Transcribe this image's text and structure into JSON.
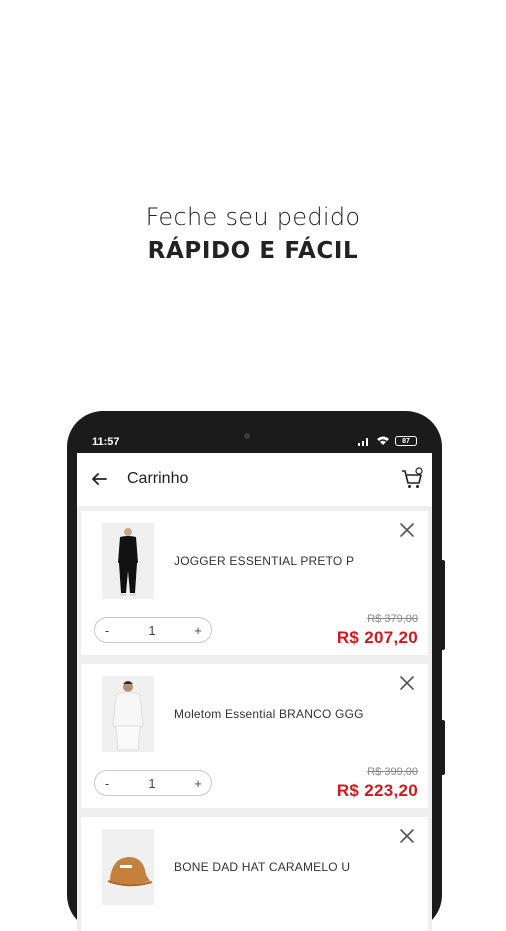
{
  "headline": {
    "line1": "Feche seu pedido",
    "line2": "RÁPIDO E FÁCIL"
  },
  "status_bar": {
    "time": "11:57",
    "battery": "87"
  },
  "appbar": {
    "title": "Carrinho"
  },
  "cart_items": [
    {
      "name": "JOGGER ESSENTIAL PRETO P",
      "quantity": "1",
      "old_price": "R$ 379,00",
      "price": "R$  207,20",
      "minus": "-",
      "plus": "+"
    },
    {
      "name": "Moletom Essential BRANCO GGG",
      "quantity": "1",
      "old_price": "R$ 399,00",
      "price": "R$  223,20",
      "minus": "-",
      "plus": "+"
    },
    {
      "name": "BONE DAD HAT CARAMELO U"
    }
  ],
  "colors": {
    "price_red": "#d0191f",
    "background": "#efefef"
  }
}
